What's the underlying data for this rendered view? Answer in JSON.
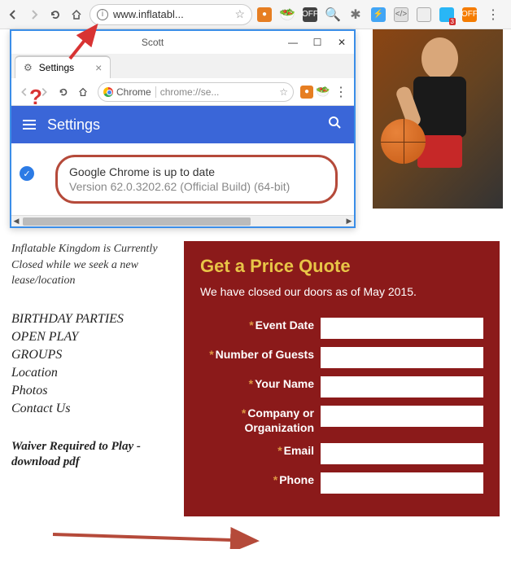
{
  "main_browser": {
    "url_display": "www.inflatabl...",
    "ext_colors": [
      "#e67e22",
      "#7cb342",
      "#424242",
      "#29b6f6",
      "#757575",
      "#42a5f5",
      "#9e9e9e",
      "#bdbdbd",
      "#29b6f6",
      "#f57c00"
    ]
  },
  "popup": {
    "titlebar": "Scott",
    "tab_label": "Settings",
    "url_scheme_label": "Chrome",
    "url_text": "chrome://se...",
    "header_title": "Settings",
    "update_line1": "Google Chrome is up to date",
    "update_line2": "Version 62.0.3202.62 (Official Build) (64-bit)"
  },
  "sidebar": {
    "notice": "Inflatable Kingdom is Currently Closed while we seek a new lease/location",
    "nav": [
      "BIRTHDAY PARTIES",
      "OPEN PLAY",
      "GROUPS",
      "Location",
      "Photos",
      "Contact Us"
    ],
    "waiver": "Waiver Required to Play - download pdf"
  },
  "quote": {
    "title": "Get a Price Quote",
    "subtitle": "We have closed our doors as of May 2015.",
    "fields": [
      {
        "label": "Event Date"
      },
      {
        "label": "Number of Guests"
      },
      {
        "label": "Your Name"
      },
      {
        "label": "Company or Organization"
      },
      {
        "label": "Email"
      },
      {
        "label": "Phone"
      }
    ]
  },
  "annotations": {
    "question_mark": "?"
  }
}
